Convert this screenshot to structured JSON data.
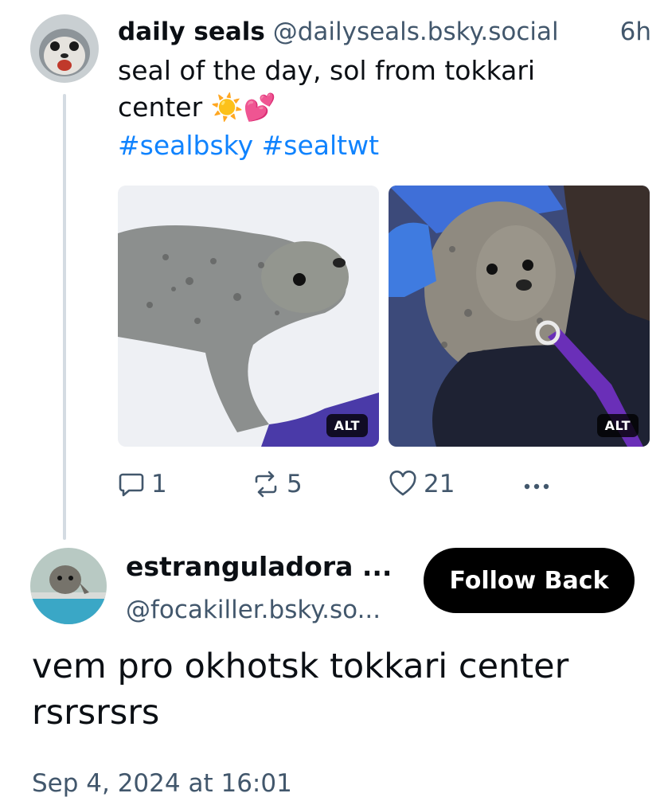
{
  "parent_post": {
    "author_name": "daily seals",
    "author_handle": "@dailyseals.bsky.social",
    "time_ago": "6h",
    "text": "seal of the day, sol from tokkari center",
    "text_emoji": "☀️💕",
    "hashtags": [
      "#sealbsky",
      "#sealtwt"
    ],
    "images": [
      {
        "alt_badge": "ALT"
      },
      {
        "alt_badge": "ALT"
      }
    ],
    "actions": {
      "reply_count": "1",
      "repost_count": "5",
      "like_count": "21"
    }
  },
  "reply": {
    "author_name": "estranguladora ...",
    "author_handle": "@focakiller.bsky.so...",
    "follow_label": "Follow Back",
    "text": "vem pro okhotsk tokkari center rsrsrsrs",
    "timestamp": "Sep 4, 2024 at 16:01"
  },
  "colors": {
    "accent_link": "#1083fe",
    "muted_text": "#42576c",
    "thread_line": "#d4dbe2",
    "button_bg": "#000000"
  },
  "icons": [
    "reply-icon",
    "repost-icon",
    "like-icon",
    "more-icon"
  ]
}
